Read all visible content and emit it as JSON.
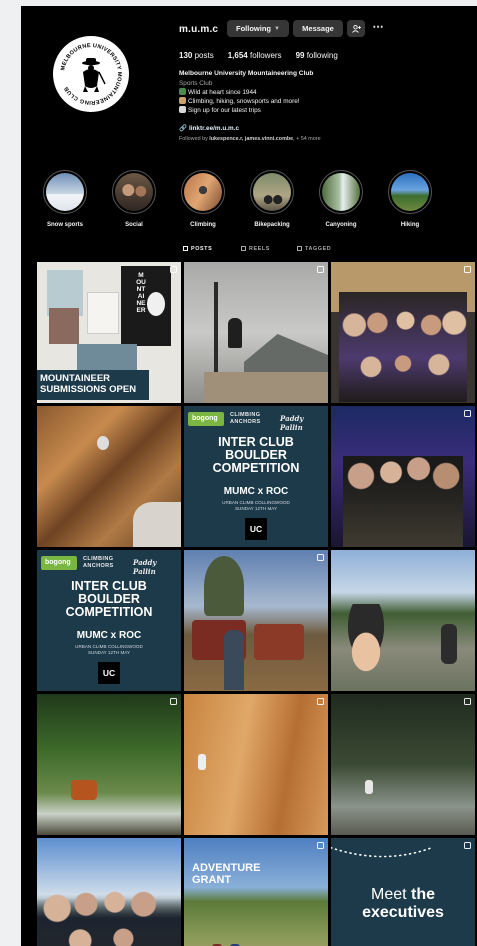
{
  "profile": {
    "username": "m.u.m.c",
    "following_label": "Following",
    "message_label": "Message",
    "stats": {
      "posts": "130",
      "posts_label": "posts",
      "followers": "1,654",
      "followers_label": "followers",
      "following": "99",
      "following_label": "following"
    },
    "full_name": "Melbourne University Mountaineering Club",
    "category": "Sports Club",
    "bio": [
      "Wild at heart since 1944",
      "Climbing, hiking, snowsports and more!",
      "Sign up for our latest trips"
    ],
    "link": "linktr.ee/m.u.m.c",
    "followed_by_prefix": "Followed by ",
    "followed_by_names": "lukespence.r, james.vinni.combe",
    "followed_by_suffix": ", + 54 more",
    "logo_ring_text": "MELBOURNE UNIVERSITY MOUNTAINEERING CLUB"
  },
  "highlights": [
    {
      "label": "Snow sports"
    },
    {
      "label": "Social"
    },
    {
      "label": "Climbing"
    },
    {
      "label": "Bikepacking"
    },
    {
      "label": "Canyoning"
    },
    {
      "label": "Hiking"
    }
  ],
  "tabs": [
    {
      "label": "POSTS",
      "active": true
    },
    {
      "label": "REELS",
      "active": false
    },
    {
      "label": "TAGGED",
      "active": false
    }
  ],
  "posts": {
    "p1": {
      "line1": "MOUNTAINEER",
      "line2": "SUBMISSIONS OPEN",
      "side": "MOUNTAINEER"
    },
    "p5": {
      "brand": "bogong",
      "sponsor1": "CLIMBING ANCHORS",
      "sponsor2": "Paddy Pallin",
      "title1": "INTER CLUB",
      "title2": "BOULDER",
      "title3": "COMPETITION",
      "sub": "MUMC x ROC",
      "venue": "URBAN CLIMB COLLINGWOOD",
      "date": "SUNDAY 12TH MAY",
      "logo": "UC"
    },
    "p7": {
      "brand": "bogong",
      "sponsor1": "CLIMBING ANCHORS",
      "sponsor2": "Paddy Pallin",
      "title1": "INTER CLUB",
      "title2": "BOULDER",
      "title3": "COMPETITION",
      "sub": "MUMC x ROC",
      "venue": "URBAN CLIMB COLLINGWOOD",
      "date": "SUNDAY 12TH MAY",
      "logo": "UC"
    },
    "p14": {
      "line1": "ADVENTURE",
      "line2": "GRANT"
    },
    "p15": {
      "line1": "Meet ",
      "line1b": "the",
      "line2": "executives"
    }
  },
  "colors": {
    "background": "#000000",
    "button": "#363636",
    "muted_text": "#a8a8a8",
    "link": "#e0f1ff",
    "navy_post": "#1d3a4a",
    "bogong_green": "#7bb542"
  }
}
